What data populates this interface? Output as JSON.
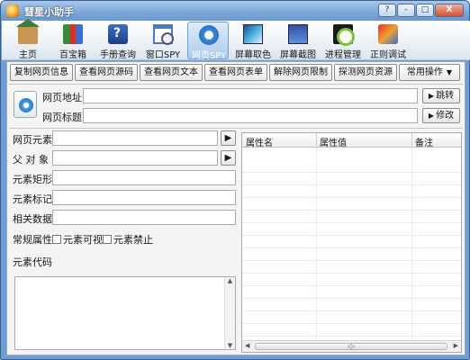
{
  "window": {
    "title": "彗星小助手",
    "btn_help": "?",
    "btn_minimize": "-",
    "btn_maximize": "□",
    "btn_close": "X"
  },
  "toolbar": {
    "items": [
      {
        "label": "主页",
        "icon": "home-icon"
      },
      {
        "label": "百宝箱",
        "icon": "toolbox-icon"
      },
      {
        "label": "手册查询",
        "icon": "manual-icon"
      },
      {
        "label": "窗口SPY",
        "icon": "window-spy-icon"
      },
      {
        "label": "网页SPY",
        "icon": "web-spy-icon",
        "active": true
      },
      {
        "label": "屏幕取色",
        "icon": "color-picker-icon"
      },
      {
        "label": "屏幕截图",
        "icon": "screenshot-icon"
      },
      {
        "label": "进程管理",
        "icon": "process-icon"
      },
      {
        "label": "正则调试",
        "icon": "regex-icon"
      }
    ]
  },
  "actions": {
    "copy_info": "复制网页信息",
    "view_source": "查看网页源码",
    "view_text": "查看网页文本",
    "view_forms": "查看网页表单",
    "remove_limits": "解除网页限制",
    "detect_resources": "探测网页资源",
    "common_ops": "常用操作"
  },
  "url_panel": {
    "address_label": "网页地址",
    "address_value": "",
    "title_label": "网页标题",
    "title_value": "",
    "goto_label": "跳转",
    "edit_label": "修改"
  },
  "element_panel": {
    "element_label": "网页元素",
    "parent_label": "父 对 象",
    "rect_label": "元素矩形",
    "tag_label": "元素标记",
    "data_label": "相关数据",
    "attrs_label": "常规属性",
    "visible_label": "元素可视",
    "disabled_label": "元素禁止",
    "code_label": "元素代码"
  },
  "grid": {
    "columns": [
      "属性名",
      "属性值",
      "备注"
    ],
    "scroll_grip": "‹◊›"
  },
  "colors": {
    "title_bar": "#7aa6d8",
    "accent": "#6e9ed4",
    "panel_bg": "#f4f4f4"
  }
}
